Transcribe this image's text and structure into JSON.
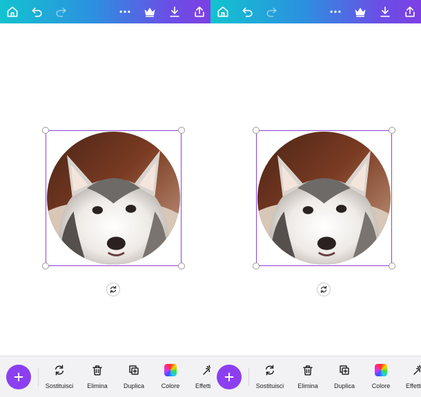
{
  "toolbar": {
    "tools": [
      {
        "label": "Sostituisci",
        "icon": "replace-icon"
      },
      {
        "label": "Elimina",
        "icon": "trash-icon"
      },
      {
        "label": "Duplica",
        "icon": "duplicate-icon"
      },
      {
        "label": "Colore",
        "icon": "color-swatch-icon"
      },
      {
        "label": "Effetti",
        "icon": "magic-wand-icon"
      }
    ]
  },
  "colors": {
    "accent": "#8c3ff0",
    "selection": "#8b3fd9",
    "header_gradient": [
      "#12c3cf",
      "#7d3fe3"
    ]
  }
}
